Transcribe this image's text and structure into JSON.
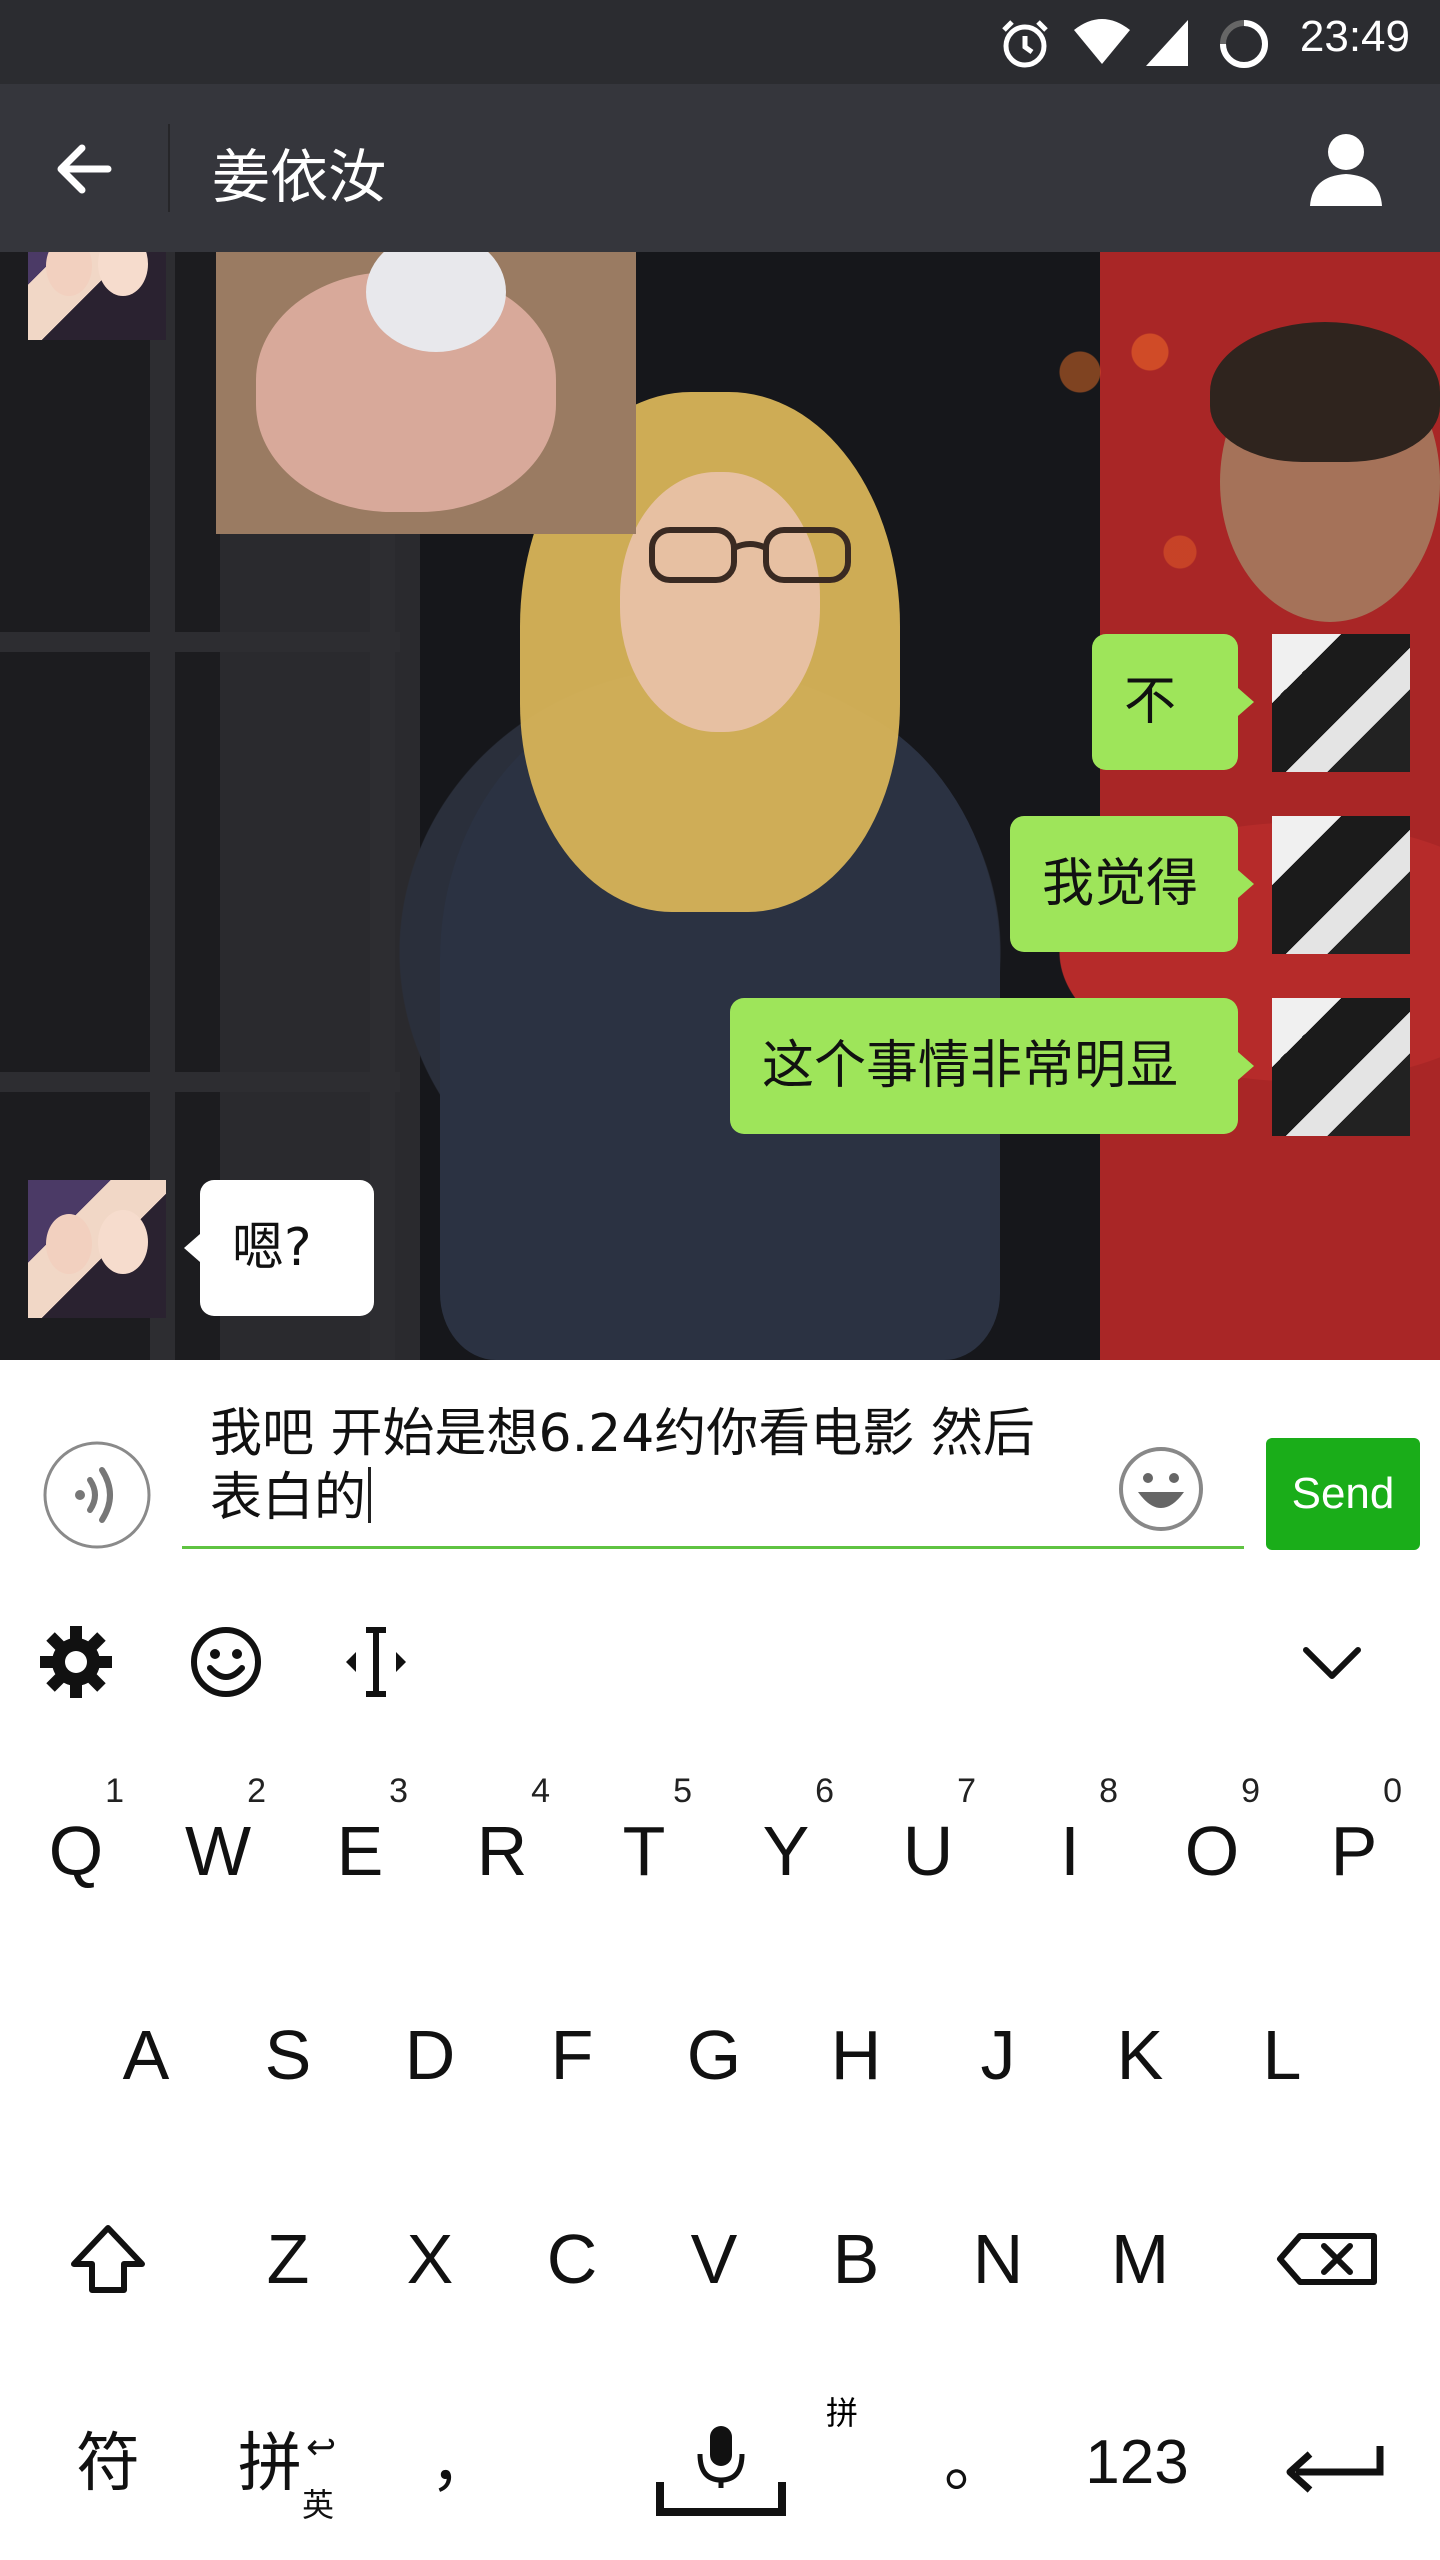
{
  "status_bar": {
    "time": "23:49",
    "icons": [
      "alarm-icon",
      "wifi-icon",
      "cell-signal-icon",
      "loading-icon"
    ]
  },
  "header": {
    "title": "姜依汝"
  },
  "chat": {
    "messages": [
      {
        "side": "right",
        "text": "不"
      },
      {
        "side": "right",
        "text": "我觉得"
      },
      {
        "side": "right",
        "text": "这个事情非常明显"
      },
      {
        "side": "left",
        "text": "嗯?"
      }
    ]
  },
  "input": {
    "line1": "我吧 开始是想6.24约你看电影 然后",
    "line2": "表白的",
    "send_label": "Send"
  },
  "keyboard": {
    "toolbar_icons": [
      "gear-icon",
      "smiley-icon",
      "cursor-move-icon",
      "chevron-down-icon"
    ],
    "row1": [
      {
        "k": "Q",
        "s": "1"
      },
      {
        "k": "W",
        "s": "2"
      },
      {
        "k": "E",
        "s": "3"
      },
      {
        "k": "R",
        "s": "4"
      },
      {
        "k": "T",
        "s": "5"
      },
      {
        "k": "Y",
        "s": "6"
      },
      {
        "k": "U",
        "s": "7"
      },
      {
        "k": "I",
        "s": "8"
      },
      {
        "k": "O",
        "s": "9"
      },
      {
        "k": "P",
        "s": "0"
      }
    ],
    "row2": [
      "A",
      "S",
      "D",
      "F",
      "G",
      "H",
      "J",
      "K",
      "L"
    ],
    "row3": [
      "Z",
      "X",
      "C",
      "V",
      "B",
      "N",
      "M"
    ],
    "bottom": {
      "symbols": "符",
      "pinyin": "拼",
      "pinyin_sub": "英",
      "comma": "，",
      "space_label": "拼",
      "period": "。",
      "numbers": "123"
    }
  }
}
